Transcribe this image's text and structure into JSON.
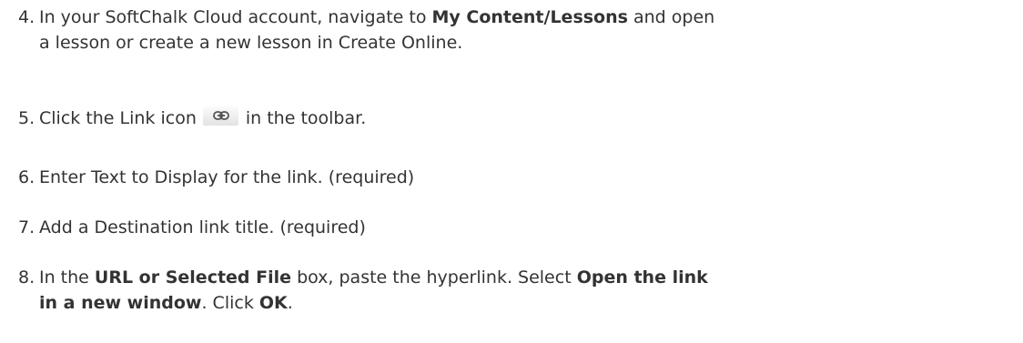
{
  "steps": [
    {
      "number": "4.",
      "parts": [
        {
          "text": "In your SoftChalk Cloud account, navigate to "
        },
        {
          "bold": "My Content/Lessons"
        },
        {
          "text": " and open"
        },
        {
          "text": "a lesson or create a new lesson in Create Online."
        }
      ]
    },
    {
      "number": "5.",
      "parts": [
        {
          "text": "Click the Link icon"
        },
        {
          "icon": "link-icon"
        },
        {
          "text": "in the toolbar."
        }
      ]
    },
    {
      "number": "6.",
      "parts": [
        {
          "text": "Enter Text to Display for the link. (required)"
        }
      ]
    },
    {
      "number": "7.",
      "parts": [
        {
          "text": "Add a Destination link title. (required)"
        }
      ]
    },
    {
      "number": "8.",
      "parts": [
        {
          "text": "In the "
        },
        {
          "bold": "URL or Selected File"
        },
        {
          "text": " box, paste the hyperlink. Select "
        },
        {
          "bold": "Open the link"
        },
        {
          "bold": "in a new window"
        },
        {
          "text": ". Click "
        },
        {
          "bold": "OK"
        },
        {
          "text": "."
        }
      ]
    }
  ]
}
